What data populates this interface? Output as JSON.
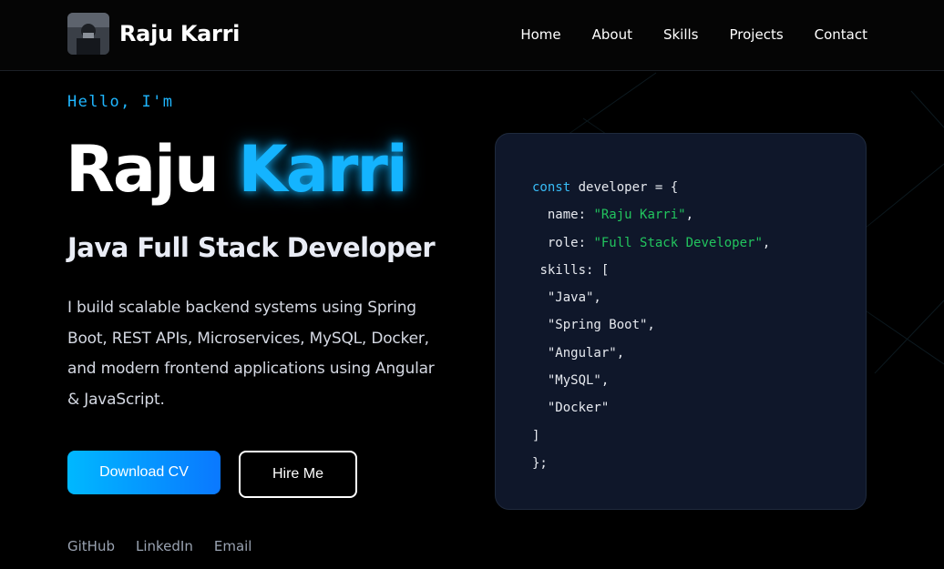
{
  "header": {
    "brand_name": "Raju Karri",
    "nav": [
      "Home",
      "About",
      "Skills",
      "Projects",
      "Contact"
    ]
  },
  "hero": {
    "greeting": "Hello, I'm",
    "first_name": "Raju",
    "last_name": "Karri",
    "role": "Java Full Stack Developer",
    "intro": "I build scalable backend systems using Spring Boot, REST APIs, Microservices, MySQL, Docker, and modern frontend applications using Angular & JavaScript.",
    "download_cv_label": "Download CV",
    "hire_me_label": "Hire Me",
    "social_links": [
      "GitHub",
      "LinkedIn",
      "Email"
    ]
  },
  "code_card": {
    "lines": [
      {
        "indent": "",
        "parts": [
          {
            "t": "const",
            "c": "kw"
          },
          {
            "t": " developer = {",
            "c": ""
          }
        ]
      },
      {
        "indent": "  ",
        "parts": [
          {
            "t": "name: ",
            "c": ""
          },
          {
            "t": "\"Raju Karri\"",
            "c": "str"
          },
          {
            "t": ",",
            "c": ""
          }
        ]
      },
      {
        "indent": "  ",
        "parts": [
          {
            "t": "role: ",
            "c": ""
          },
          {
            "t": "\"Full Stack Developer\"",
            "c": "str"
          },
          {
            "t": ",",
            "c": ""
          }
        ]
      },
      {
        "indent": " ",
        "parts": [
          {
            "t": "skills: [",
            "c": ""
          }
        ]
      },
      {
        "indent": "  ",
        "parts": [
          {
            "t": "\"Java\",",
            "c": ""
          }
        ]
      },
      {
        "indent": "  ",
        "parts": [
          {
            "t": "\"Spring Boot\",",
            "c": ""
          }
        ]
      },
      {
        "indent": "  ",
        "parts": [
          {
            "t": "\"Angular\",",
            "c": ""
          }
        ]
      },
      {
        "indent": "  ",
        "parts": [
          {
            "t": "\"MySQL\",",
            "c": ""
          }
        ]
      },
      {
        "indent": "  ",
        "parts": [
          {
            "t": "\"Docker\"",
            "c": ""
          }
        ]
      },
      {
        "indent": "",
        "parts": [
          {
            "t": "]",
            "c": ""
          }
        ]
      },
      {
        "indent": "",
        "parts": [
          {
            "t": "};",
            "c": ""
          }
        ]
      }
    ]
  },
  "colors": {
    "accent": "#14b4ff",
    "keyword": "#38bdf8",
    "string": "#22c55e",
    "card_bg": "#0f172a",
    "page_bg": "#000000"
  },
  "icons": {
    "avatar": "profile-photo"
  }
}
